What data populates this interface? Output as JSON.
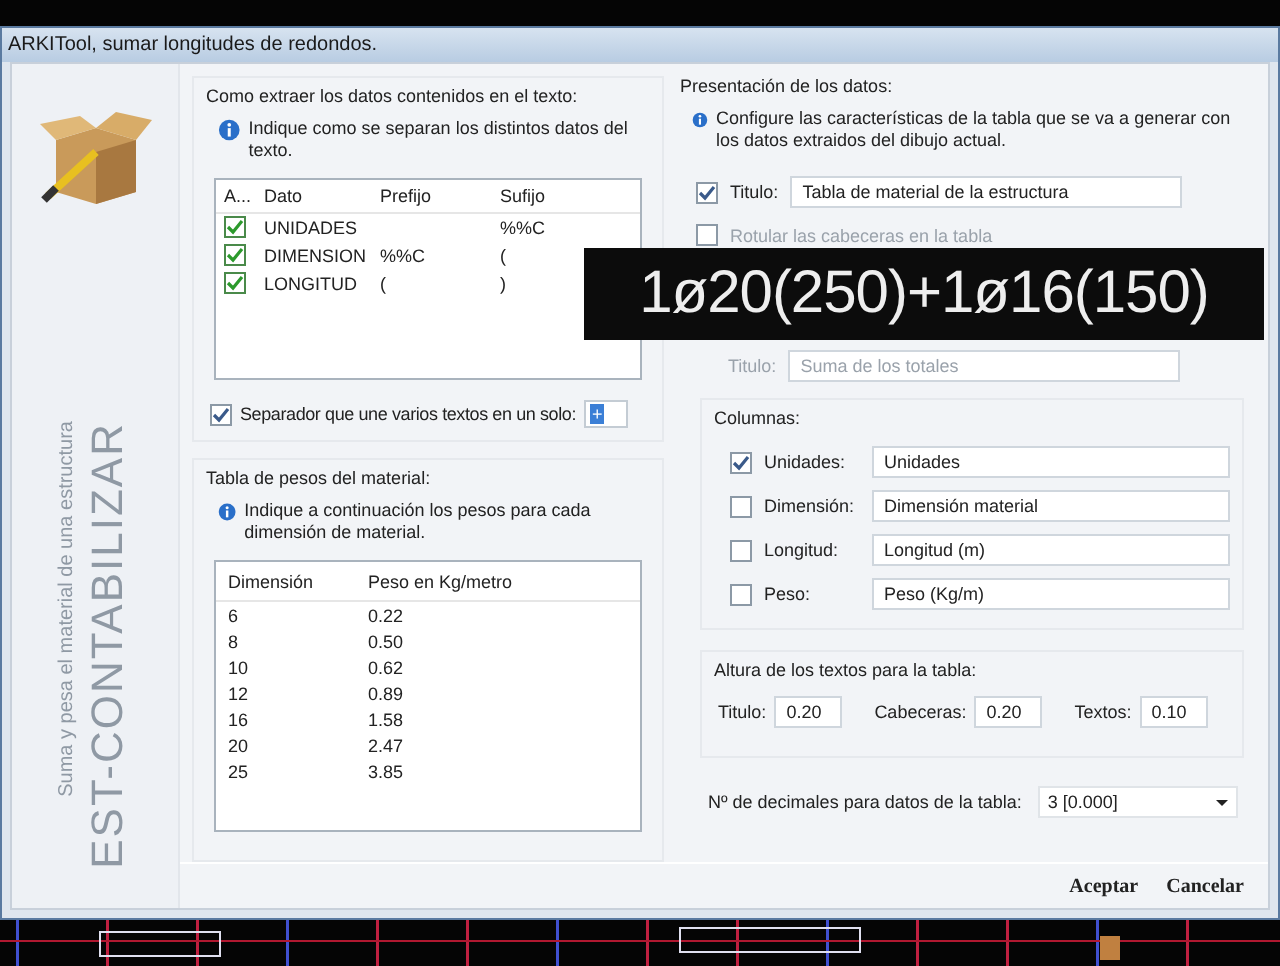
{
  "window": {
    "title": "ARKITool, sumar longitudes de redondos."
  },
  "sidebar": {
    "title": "EST-CONTABILIZAR",
    "subtitle": "Suma y pesa el material de una estructura"
  },
  "extraction": {
    "heading": "Como extraer los datos contenidos en el texto:",
    "info": "Indique como se separan los distintos datos del texto.",
    "check_column": "A...",
    "columns": [
      "Dato",
      "Prefijo",
      "Sufijo"
    ],
    "rows": [
      {
        "checked": true,
        "cells": [
          "UNIDADES",
          "",
          "%%C"
        ]
      },
      {
        "checked": true,
        "cells": [
          "DIMENSION",
          "%%C",
          "("
        ]
      },
      {
        "checked": true,
        "cells": [
          "LONGITUD",
          "(",
          ")"
        ]
      }
    ],
    "separator": {
      "checked": true,
      "label": "Separador que une varios textos en un solo:",
      "value": "+"
    }
  },
  "weights": {
    "heading": "Tabla de pesos del material:",
    "info": "Indique a continuación los pesos para cada dimensión de material.",
    "columns": [
      "Dimensión",
      "Peso en Kg/metro"
    ],
    "rows": [
      [
        "6",
        "0.22"
      ],
      [
        "8",
        "0.50"
      ],
      [
        "10",
        "0.62"
      ],
      [
        "12",
        "0.89"
      ],
      [
        "16",
        "1.58"
      ],
      [
        "20",
        "2.47"
      ],
      [
        "25",
        "3.85"
      ]
    ]
  },
  "presentation": {
    "heading": "Presentación de los datos:",
    "info": "Configure las características de la tabla que se va a generar con los datos extraidos del dibujo actual.",
    "title_option": {
      "checked": true,
      "label": "Titulo:",
      "value": "Tabla de material de la estructura"
    },
    "header_option": {
      "checked": false,
      "label": "Rotular las cabeceras en la tabla"
    },
    "total_field": {
      "label": "Titulo:",
      "value": "Suma de los totales"
    }
  },
  "columns": {
    "heading": "Columnas:",
    "items": [
      {
        "checked": true,
        "label": "Unidades:",
        "value": "Unidades"
      },
      {
        "checked": false,
        "label": "Dimensión:",
        "value": "Dimensión material"
      },
      {
        "checked": false,
        "label": "Longitud:",
        "value": "Longitud (m)"
      },
      {
        "checked": false,
        "label": "Peso:",
        "value": "Peso (Kg/m)"
      }
    ]
  },
  "text_heights": {
    "heading": "Altura de los textos para la tabla:",
    "fields": [
      {
        "label": "Titulo:",
        "value": "0.20"
      },
      {
        "label": "Cabeceras:",
        "value": "0.20"
      },
      {
        "label": "Textos:",
        "value": "0.10"
      }
    ]
  },
  "decimals": {
    "label": "Nº de decimales para datos de la tabla:",
    "value": "3 [0.000]"
  },
  "buttons": [
    "Aceptar",
    "Cancelar"
  ],
  "overlay": {
    "text": "1ø20(250)+1ø16(150)"
  }
}
